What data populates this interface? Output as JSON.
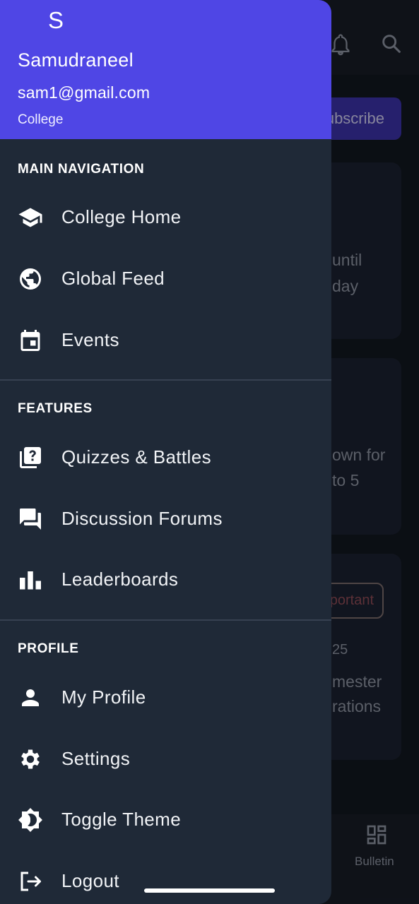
{
  "background_app": {
    "subscribe_label": "Subscribe",
    "card1_lines": [
      "until",
      "day"
    ],
    "card2_lines": [
      "own for",
      "to 5"
    ],
    "badge_label": "Important",
    "card3_date": "25",
    "card3_lines": [
      "mester",
      "rations"
    ],
    "bulletin_label": "Bulletin",
    "icons": [
      "bell-icon",
      "search-icon",
      "bulletin-icon"
    ]
  },
  "drawer": {
    "header": {
      "avatar_letter": "S",
      "name": "Samudraneel",
      "email": "sam1@gmail.com",
      "college": "College",
      "color": "#4f46e5"
    },
    "sections": [
      {
        "title": "MAIN NAVIGATION",
        "items": [
          {
            "label": "College Home",
            "icon": "school-icon"
          },
          {
            "label": "Global Feed",
            "icon": "globe-icon"
          },
          {
            "label": "Events",
            "icon": "calendar-icon"
          }
        ]
      },
      {
        "title": "FEATURES",
        "items": [
          {
            "label": "Quizzes & Battles",
            "icon": "quiz-icon"
          },
          {
            "label": "Discussion Forums",
            "icon": "forum-icon"
          },
          {
            "label": "Leaderboards",
            "icon": "leaderboard-icon"
          }
        ]
      },
      {
        "title": "PROFILE",
        "items": [
          {
            "label": "My Profile",
            "icon": "person-icon"
          },
          {
            "label": "Settings",
            "icon": "gear-icon"
          },
          {
            "label": "Toggle Theme",
            "icon": "theme-icon"
          },
          {
            "label": "Logout",
            "icon": "logout-icon"
          }
        ]
      }
    ]
  }
}
